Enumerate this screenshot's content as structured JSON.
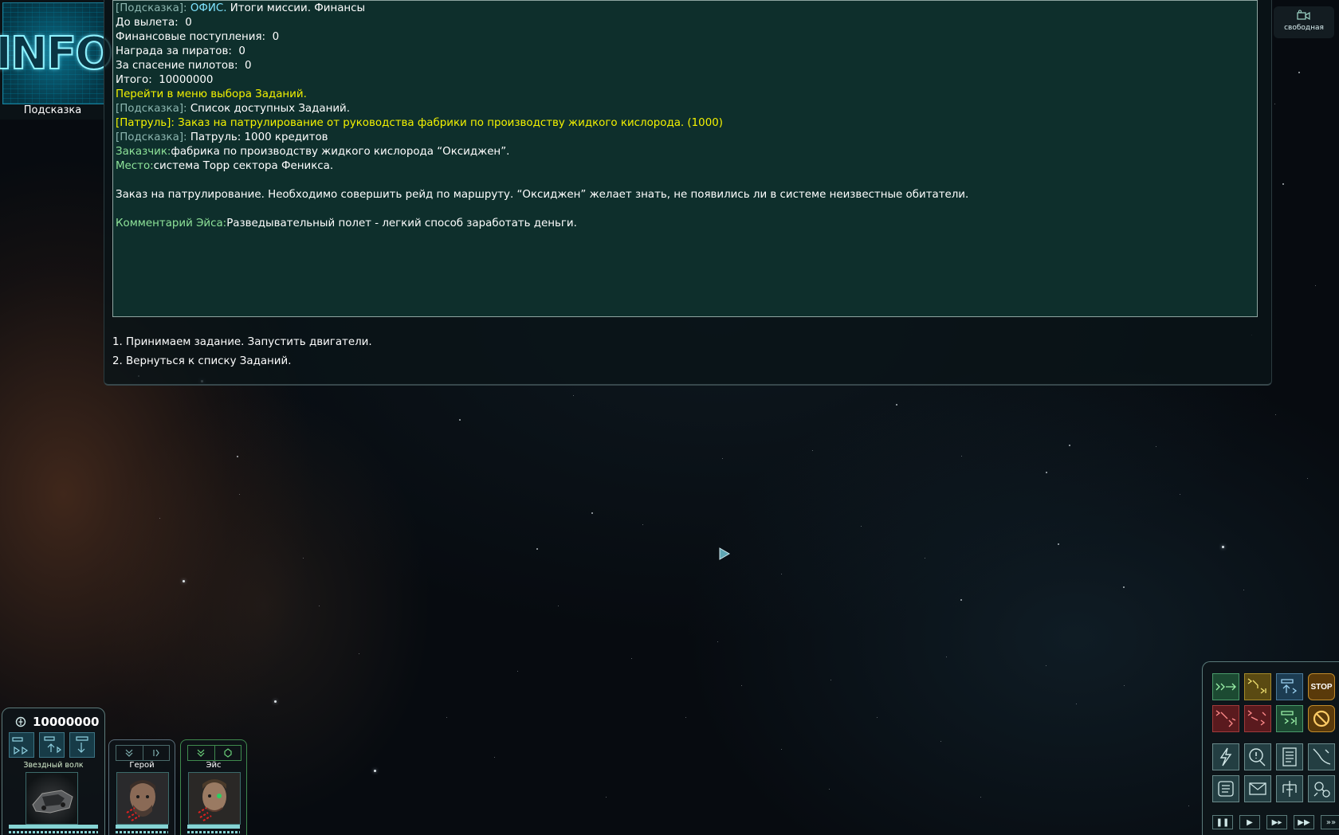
{
  "info_panel": {
    "logo_text": "INFO",
    "caption": "Подсказка"
  },
  "messages": [
    {
      "segments": [
        {
          "text": "[Подсказка]:",
          "style": "gray"
        },
        {
          "text": " ОФИС.",
          "style": "cyan"
        },
        {
          "text": " Итоги миссии. Финансы",
          "style": "white"
        }
      ]
    },
    {
      "segments": [
        {
          "text": "До вылета:  0",
          "style": "white"
        }
      ]
    },
    {
      "segments": [
        {
          "text": "Финансовые поступления:  0",
          "style": "white"
        }
      ]
    },
    {
      "segments": [
        {
          "text": "Награда за пиратов:  0",
          "style": "white"
        }
      ]
    },
    {
      "segments": [
        {
          "text": "За спасение пилотов:  0",
          "style": "white"
        }
      ]
    },
    {
      "segments": [
        {
          "text": "Итого:  10000000",
          "style": "white"
        }
      ]
    },
    {
      "segments": [
        {
          "text": "Перейти в меню выбора Заданий.",
          "style": "yellow"
        }
      ]
    },
    {
      "segments": [
        {
          "text": "[Подсказка]:",
          "style": "gray"
        },
        {
          "text": " Список доступных Заданий.",
          "style": "white"
        }
      ]
    },
    {
      "segments": [
        {
          "text": "[Патруль]: Заказ на патрулирование от руководства фабрики по производству жидкого кислорода. (1000)",
          "style": "yellow"
        }
      ]
    },
    {
      "segments": [
        {
          "text": "[Подсказка]:",
          "style": "gray"
        },
        {
          "text": " Патруль: 1000 кредитов",
          "style": "white"
        }
      ]
    },
    {
      "segments": [
        {
          "text": "Заказчик:",
          "style": "green"
        },
        {
          "text": "фабрика по производству жидкого кислорода “Оксиджен”.",
          "style": "white"
        }
      ]
    },
    {
      "segments": [
        {
          "text": "Место:",
          "style": "green"
        },
        {
          "text": "система Торр сектора Феникса.",
          "style": "white"
        }
      ]
    },
    {
      "segments": []
    },
    {
      "segments": [
        {
          "text": "Заказ на патрулирование. Необходимо совершить рейд по маршруту. “Оксиджен” желает знать, не появились ли в системе неизвестные обитатели.",
          "style": "white"
        }
      ]
    },
    {
      "segments": []
    },
    {
      "segments": [
        {
          "text": "Комментарий Эйса:",
          "style": "green"
        },
        {
          "text": "Разведывательный полет - легкий способ заработать деньги.",
          "style": "white"
        }
      ]
    }
  ],
  "options": [
    "1. Принимаем задание. Запустить двигатели.",
    "2. Вернуться к списку Заданий."
  ],
  "top_right": {
    "label": "свободная",
    "icon": "camera-icon"
  },
  "ship_panel": {
    "credits": "10000000",
    "ship_name": "Звездный волк"
  },
  "crew": [
    {
      "name": "Герой"
    },
    {
      "name": "Эйс"
    }
  ],
  "command_panel": {
    "stop_label": "STOP"
  },
  "colors": {
    "message_bg": "#0e2f2c",
    "hint_tag": "#8eb7b1",
    "office": "#7fe3ff",
    "highlight": "#f4f200",
    "label_green": "#8fe49a"
  }
}
